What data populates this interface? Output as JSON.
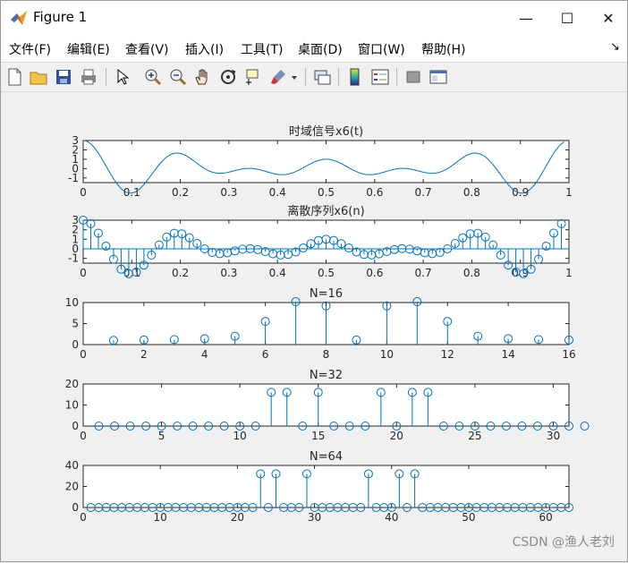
{
  "window": {
    "title": "Figure 1",
    "minimize_glyph": "—",
    "maximize_glyph": "☐",
    "close_glyph": "✕"
  },
  "menu": [
    {
      "id": "file",
      "label": "文件(F)"
    },
    {
      "id": "edit",
      "label": "编辑(E)"
    },
    {
      "id": "view",
      "label": "查看(V)"
    },
    {
      "id": "insert",
      "label": "插入(I)"
    },
    {
      "id": "tools",
      "label": "工具(T)"
    },
    {
      "id": "desktop",
      "label": "桌面(D)"
    },
    {
      "id": "window",
      "label": "窗口(W)"
    },
    {
      "id": "help",
      "label": "帮助(H)"
    }
  ],
  "menu_overflow_glyph": "↘",
  "toolbar": [
    "new-figure-icon",
    "open-file-icon",
    "save-icon",
    "print-icon",
    "pointer-icon",
    "zoom-in-icon",
    "zoom-out-icon",
    "pan-hand-icon",
    "rotate-3d-icon",
    "data-cursor-icon",
    "brush-icon",
    "dropdown-arrow-icon",
    "link-plot-icon",
    "colorbar-icon",
    "legend-icon",
    "hide-plot-tools-icon",
    "show-plot-tools-icon"
  ],
  "watermark": "CSDN @渔人老刘",
  "colors": {
    "plot": "#0072BD",
    "axes": "#262626",
    "figure_bg": "#f0f0f0"
  },
  "chart_data": [
    {
      "type": "line",
      "title": "时域信号x6(t)",
      "xlim": [
        0,
        1
      ],
      "ylim": [
        -1.5,
        3
      ],
      "xticks": [
        0,
        0.1,
        0.2,
        0.3,
        0.4,
        0.5,
        0.6,
        0.7,
        0.8,
        0.9,
        1
      ],
      "xtick_labels": [
        "0",
        "0.1",
        "0.2",
        "0.3",
        "0.4",
        "0.5",
        "0.6",
        "0.7",
        "0.8",
        "0.9",
        "1"
      ],
      "yticks": [
        -1,
        0,
        1,
        2,
        3
      ],
      "ytick_labels": [
        "-1",
        "0",
        "1",
        "2",
        "3"
      ],
      "series": [
        {
          "function": "cos(2π·4t)+cos(2π·5t)+cos(2π·6t), t ∈ [0, 0.99]"
        }
      ]
    },
    {
      "type": "stem",
      "title": "离散序列x6(n)",
      "xlim": [
        0,
        1
      ],
      "ylim": [
        -1.5,
        3
      ],
      "xticks": [
        0,
        0.1,
        0.2,
        0.3,
        0.4,
        0.5,
        0.6,
        0.7,
        0.8,
        0.9,
        1
      ],
      "xtick_labels": [
        "0",
        "0.1",
        "0.2",
        "0.3",
        "0.4",
        "0.5",
        "0.6",
        "0.7",
        "0.8",
        "0.9",
        "1"
      ],
      "yticks": [
        -1,
        0,
        1,
        2,
        3
      ],
      "ytick_labels": [
        "-1",
        "0",
        "1",
        "2",
        "3"
      ],
      "series": [
        {
          "x_start": 0,
          "x_step": 0.015625,
          "count": 64,
          "function": "cos(2π·4t)+cos(2π·5t)+cos(2π·6t)"
        }
      ]
    },
    {
      "type": "stem",
      "title": "N=16",
      "xlim": [
        0,
        16
      ],
      "ylim": [
        0,
        10
      ],
      "xticks": [
        0,
        2,
        4,
        6,
        8,
        10,
        12,
        14,
        16
      ],
      "xtick_labels": [
        "0",
        "2",
        "4",
        "6",
        "8",
        "10",
        "12",
        "14",
        "16"
      ],
      "yticks": [
        0,
        5,
        10
      ],
      "ytick_labels": [
        "0",
        "5",
        "10"
      ],
      "series": [
        {
          "x": [
            1,
            2,
            3,
            4,
            5,
            6,
            7,
            8,
            9,
            10,
            11,
            12,
            13,
            14,
            15,
            16
          ],
          "y": [
            1.0,
            1.1,
            1.2,
            1.4,
            2.0,
            5.5,
            10.2,
            9.2,
            1.1,
            9.2,
            10.2,
            5.5,
            2.0,
            1.4,
            1.2,
            1.1
          ]
        }
      ]
    },
    {
      "type": "stem",
      "title": "N=32",
      "xlim": [
        0,
        31
      ],
      "ylim": [
        0,
        20
      ],
      "xticks": [
        0,
        5,
        10,
        15,
        20,
        25,
        30
      ],
      "xtick_labels": [
        "0",
        "5",
        "10",
        "15",
        "20",
        "25",
        "30"
      ],
      "yticks": [
        0,
        10,
        20
      ],
      "ytick_labels": [
        "0",
        "10",
        "20"
      ],
      "series": [
        {
          "x": [
            1,
            2,
            3,
            4,
            5,
            6,
            7,
            8,
            9,
            10,
            11,
            12,
            13,
            14,
            15,
            16,
            17,
            18,
            19,
            20,
            21,
            22,
            23,
            24,
            25,
            26,
            27,
            28,
            29,
            30,
            31,
            32
          ],
          "y": [
            0,
            0,
            0,
            0,
            0,
            0,
            0,
            0,
            0,
            0,
            0,
            16,
            16,
            0,
            16,
            0,
            0,
            0,
            16,
            0,
            16,
            16,
            0,
            0,
            0,
            0,
            0,
            0,
            0,
            0,
            0,
            0
          ]
        }
      ]
    },
    {
      "type": "stem",
      "title": "N=64",
      "xlim": [
        0,
        63
      ],
      "ylim": [
        0,
        40
      ],
      "xticks": [
        0,
        10,
        20,
        30,
        40,
        50,
        60
      ],
      "xtick_labels": [
        "0",
        "10",
        "20",
        "30",
        "40",
        "50",
        "60"
      ],
      "yticks": [
        0,
        20,
        40
      ],
      "ytick_labels": [
        "0",
        "20",
        "40"
      ],
      "series": [
        {
          "x_start": 1,
          "x_step": 1,
          "count": 63,
          "baseline": 0,
          "x_nonzero": [
            23,
            25,
            29,
            37,
            41,
            43
          ],
          "y_nonzero": 32
        }
      ]
    }
  ]
}
